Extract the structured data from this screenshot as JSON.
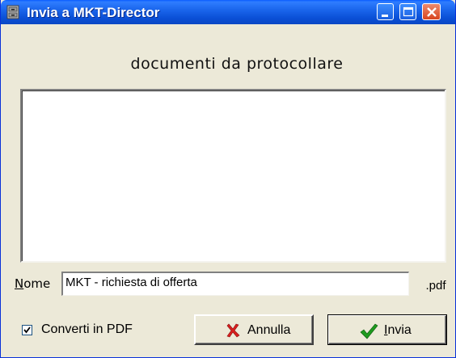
{
  "window": {
    "title": "Invia a MKT-Director",
    "app_icon": "cabinet-icon"
  },
  "titlebar_buttons": {
    "minimize": "minimize-icon",
    "maximize": "maximize-icon",
    "close": "close-icon"
  },
  "header": {
    "label": "documenti da protocollare"
  },
  "name": {
    "label": "Nome",
    "label_first": "N",
    "label_rest": "ome",
    "value": "MKT - richiesta di offerta",
    "extension": ".pdf"
  },
  "convert": {
    "label": "Converti in PDF",
    "checked": true
  },
  "buttons": {
    "cancel": {
      "label": "Annulla",
      "icon": "red-x-icon",
      "color": "#d91f1f"
    },
    "send": {
      "label": "Invia",
      "label_first": "I",
      "label_rest": "nvia",
      "icon": "green-check-icon",
      "color": "#1e9a1e"
    }
  },
  "colors": {
    "titlebar": "#0a4fd6",
    "dialog_bg": "#ece9d8",
    "close_button": "#d8451f"
  }
}
